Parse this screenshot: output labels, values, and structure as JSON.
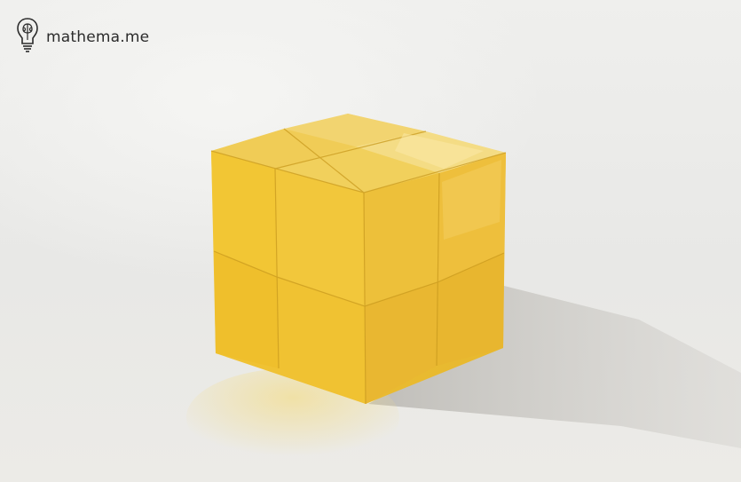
{
  "brand": {
    "name": "mathema.me",
    "icon": "brain-lightbulb-icon"
  },
  "scene": {
    "subject": "yellow-2x2-cube",
    "colors": {
      "background": "#ebebe9",
      "cube_top": "#efc64a",
      "cube_front": "#f1cb3c",
      "cube_side": "#e8b52a",
      "shadow": "#c9c7c2"
    }
  }
}
